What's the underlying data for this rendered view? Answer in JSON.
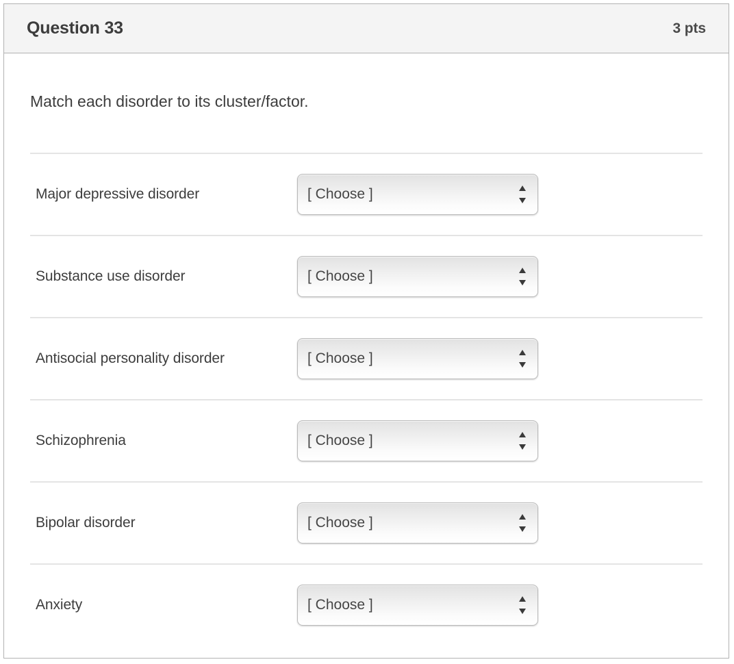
{
  "card": {
    "header": {
      "title": "Question 33",
      "points": "3 pts"
    },
    "prompt": "Match each disorder to its cluster/factor.",
    "rows": [
      {
        "label": "Major depressive disorder",
        "select_value": "[ Choose ]",
        "icon": "stepper-arrows-icon"
      },
      {
        "label": "Substance use disorder",
        "select_value": "[ Choose ]",
        "icon": "stepper-arrows-icon"
      },
      {
        "label": "Antisocial personality disorder",
        "select_value": "[ Choose ]",
        "icon": "stepper-arrows-icon"
      },
      {
        "label": "Schizophrenia",
        "select_value": "[ Choose ]",
        "icon": "stepper-arrows-icon"
      },
      {
        "label": "Bipolar disorder",
        "select_value": "[ Choose ]",
        "icon": "stepper-arrows-icon"
      },
      {
        "label": "Anxiety",
        "select_value": "[ Choose ]",
        "icon": "stepper-arrows-icon"
      }
    ]
  },
  "colors": {
    "header_background": "#f4f4f4",
    "card_border": "#b2b2b2",
    "divider": "#e4e4e4",
    "text_primary": "#3d3d3d",
    "select_border": "#b9b9b9"
  }
}
